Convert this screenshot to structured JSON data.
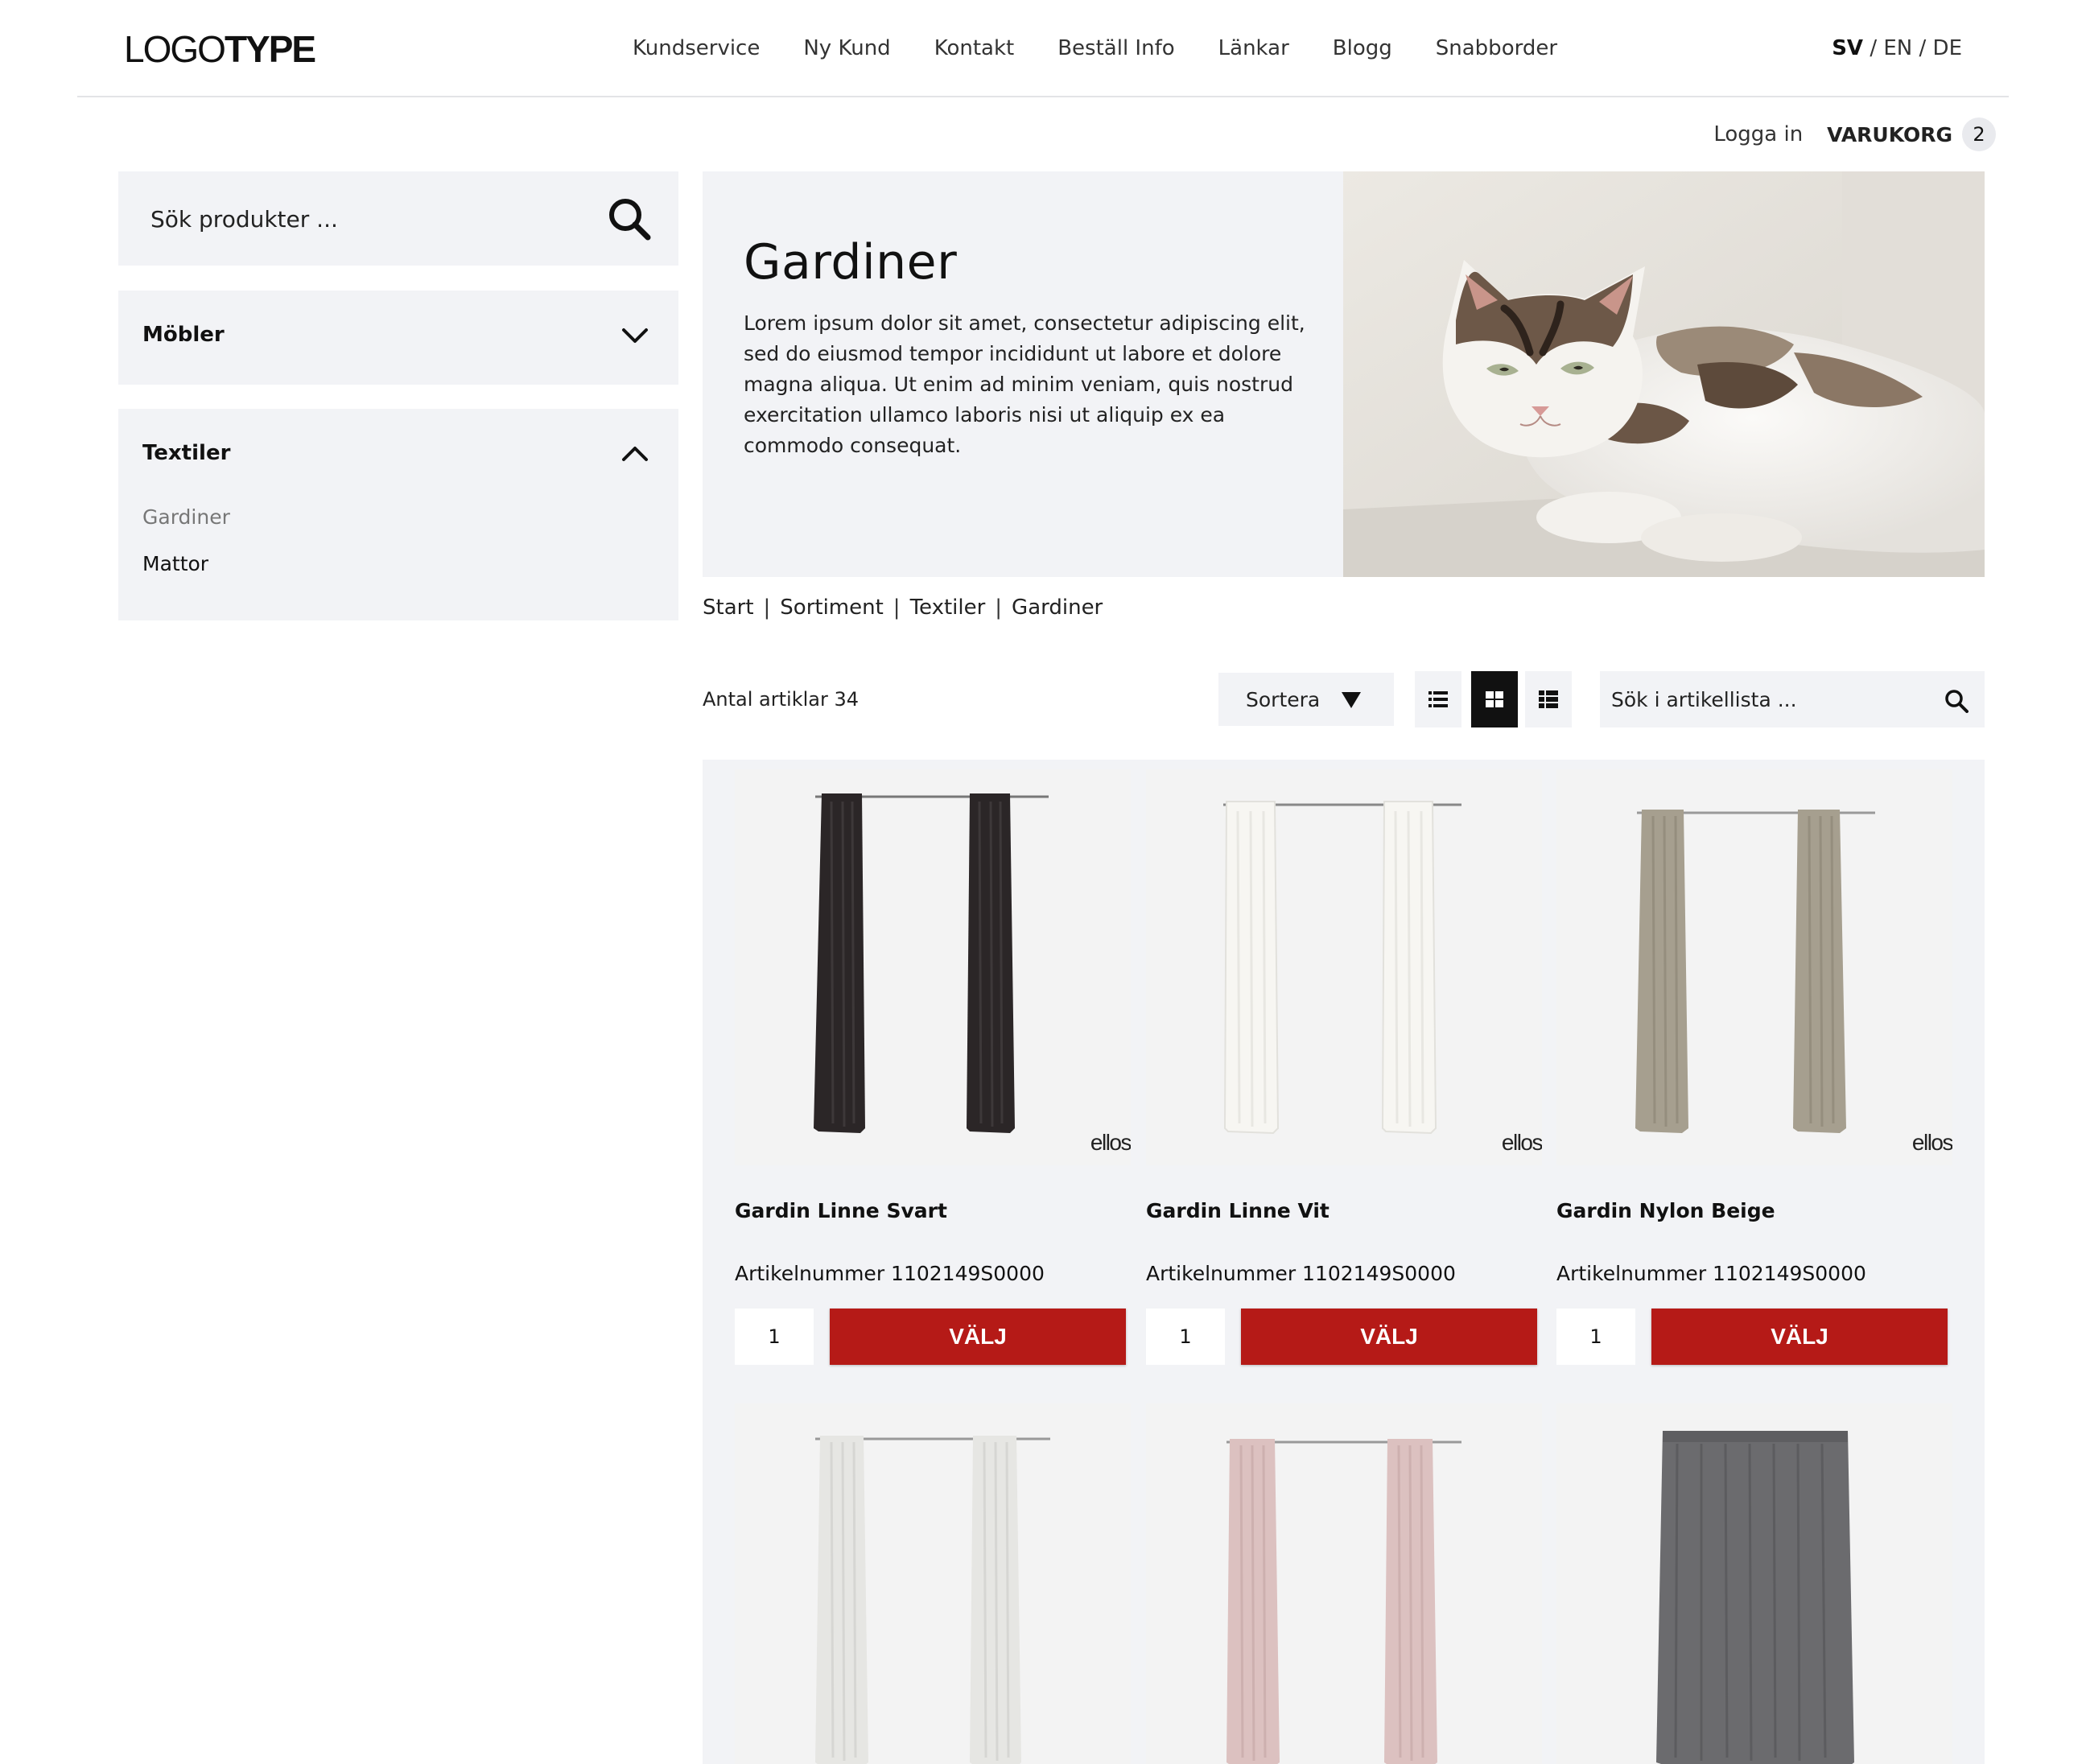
{
  "header": {
    "logo_light": "LOGO",
    "logo_bold": "TYPE",
    "nav": [
      "Kundservice",
      "Ny Kund",
      "Kontakt",
      "Beställ Info",
      "Länkar",
      "Blogg",
      "Snabborder"
    ],
    "languages": {
      "active": "SV",
      "sep1": " / ",
      "en": "EN",
      "sep2": " / ",
      "de": "DE"
    }
  },
  "utility": {
    "login": "Logga in",
    "cart_label": "VARUKORG",
    "cart_count": "2"
  },
  "sidebar": {
    "search_placeholder": "Sök produkter ...",
    "categories": [
      {
        "title": "Möbler",
        "expanded": false
      },
      {
        "title": "Textiler",
        "expanded": true,
        "items": [
          "Gardiner",
          "Mattor"
        ],
        "active_item": "Gardiner"
      }
    ]
  },
  "hero": {
    "title": "Gardiner",
    "text": "Lorem ipsum dolor sit amet, consectetur adipiscing elit, sed do eiusmod tempor incididunt ut labore et dolore magna aliqua. Ut enim ad minim veniam, quis nostrud exercitation ullamco laboris nisi ut aliquip ex ea commodo consequat."
  },
  "breadcrumb": [
    "Start",
    "Sortiment",
    "Textiler",
    "Gardiner"
  ],
  "toolbar": {
    "article_count": "Antal artiklar 34",
    "sort_label": "Sortera",
    "search_placeholder": "Sök i artikellista ...",
    "active_view": "grid"
  },
  "products": [
    {
      "name": "Gardin Linne Svart",
      "sku": "Artikelnummer 1102149S0000",
      "qty": "1",
      "button": "VÄLJ",
      "brand": "ellos",
      "color": "#2b2627"
    },
    {
      "name": "Gardin Linne Vit",
      "sku": "Artikelnummer 1102149S0000",
      "qty": "1",
      "button": "VÄLJ",
      "brand": "ellos",
      "color": "#f4f3ef"
    },
    {
      "name": "Gardin Nylon Beige",
      "sku": "Artikelnummer 1102149S0000",
      "qty": "1",
      "button": "VÄLJ",
      "brand": "ellos",
      "color": "#a69f8f"
    },
    {
      "color": "#e6e6e3"
    },
    {
      "color": "#dcc1c0"
    },
    {
      "color": "#6b6b6e"
    }
  ],
  "colors": {
    "accent": "#b51a17",
    "panel": "#f2f3f6",
    "text": "#222222"
  }
}
